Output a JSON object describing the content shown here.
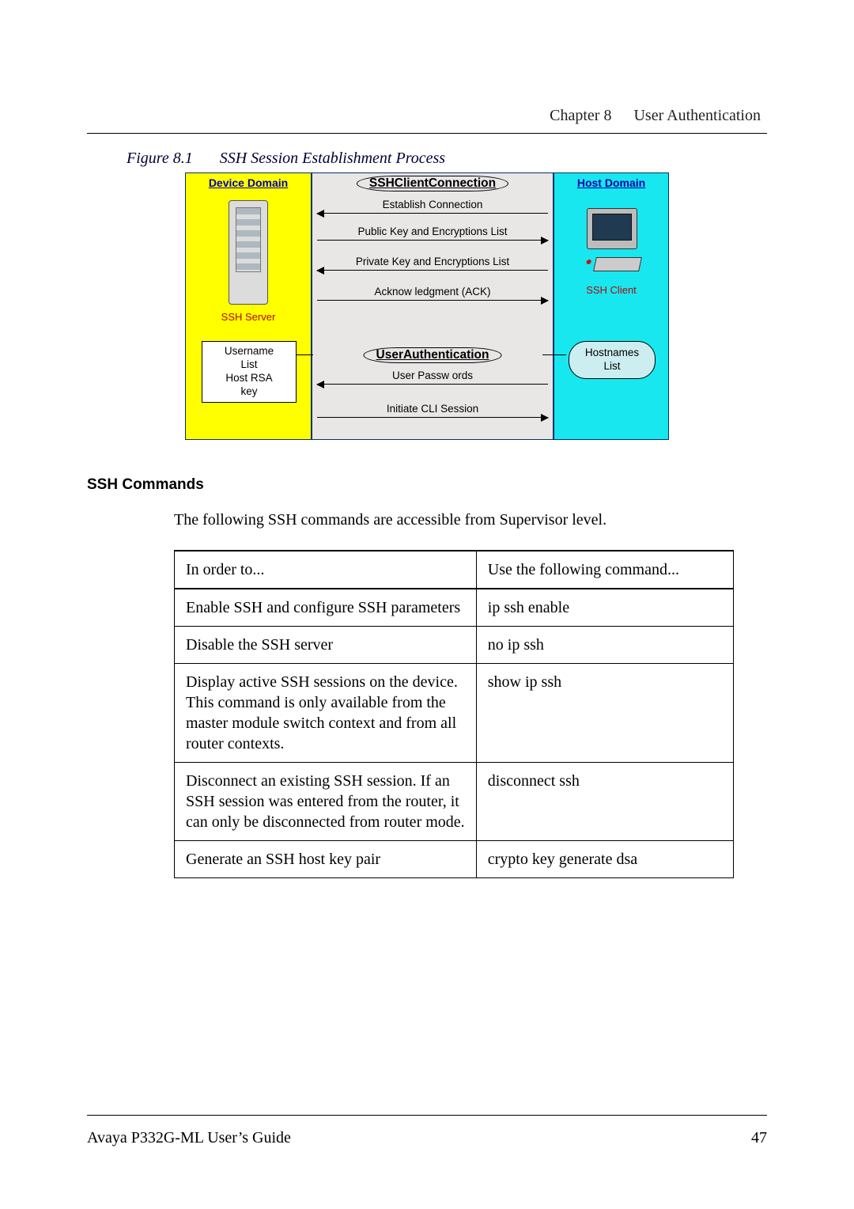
{
  "header": {
    "chapter": "Chapter 8",
    "title": "User Authentication"
  },
  "figure": {
    "label": "Figure 8.1",
    "title": "SSH Session Establishment Process",
    "device_domain": "Device Domain",
    "host_domain": "Host Domain",
    "ssh_client_connection": "SSHClientConnection",
    "user_authentication": "UserAuthentication",
    "ssh_server": "SSH Server",
    "ssh_client": "SSH  Client",
    "establish_connection": "Establish  Connection",
    "pubkey_list": "Public Key  and  Encryptions  List",
    "privkey_list": "Private Key  and Encryptions  List",
    "ack": "Acknow ledgment (ACK)",
    "user_passwords": "User Passw ords",
    "initiate_cli": "Initiate  CLI  Session",
    "username_list_l1": "Username",
    "username_list_l2": "List",
    "username_list_l3": "Host RSA",
    "username_list_l4": "key",
    "hostnames_l1": "Hostnames",
    "hostnames_l2": "List"
  },
  "section": {
    "heading": "SSH Commands",
    "intro": "The following SSH commands are accessible from Supervisor level."
  },
  "table": {
    "head_c1": "In order to...",
    "head_c2": "Use the following command...",
    "rows": [
      {
        "c1": "Enable SSH and configure SSH parameters",
        "c2": "ip ssh enable"
      },
      {
        "c1": "Disable the SSH server",
        "c2": "no ip ssh"
      },
      {
        "c1": "Display active SSH sessions on the device. This command is only available from the master module switch context and from all router contexts.",
        "c2": "show ip ssh"
      },
      {
        "c1": "Disconnect an existing SSH session. If an SSH session was entered from the router, it can only be disconnected from router mode.",
        "c2": "disconnect ssh"
      },
      {
        "c1": "Generate an SSH host key pair",
        "c2": "crypto key generate dsa"
      }
    ]
  },
  "footer": {
    "guide": "Avaya P332G-ML User’s Guide",
    "page": "47"
  }
}
